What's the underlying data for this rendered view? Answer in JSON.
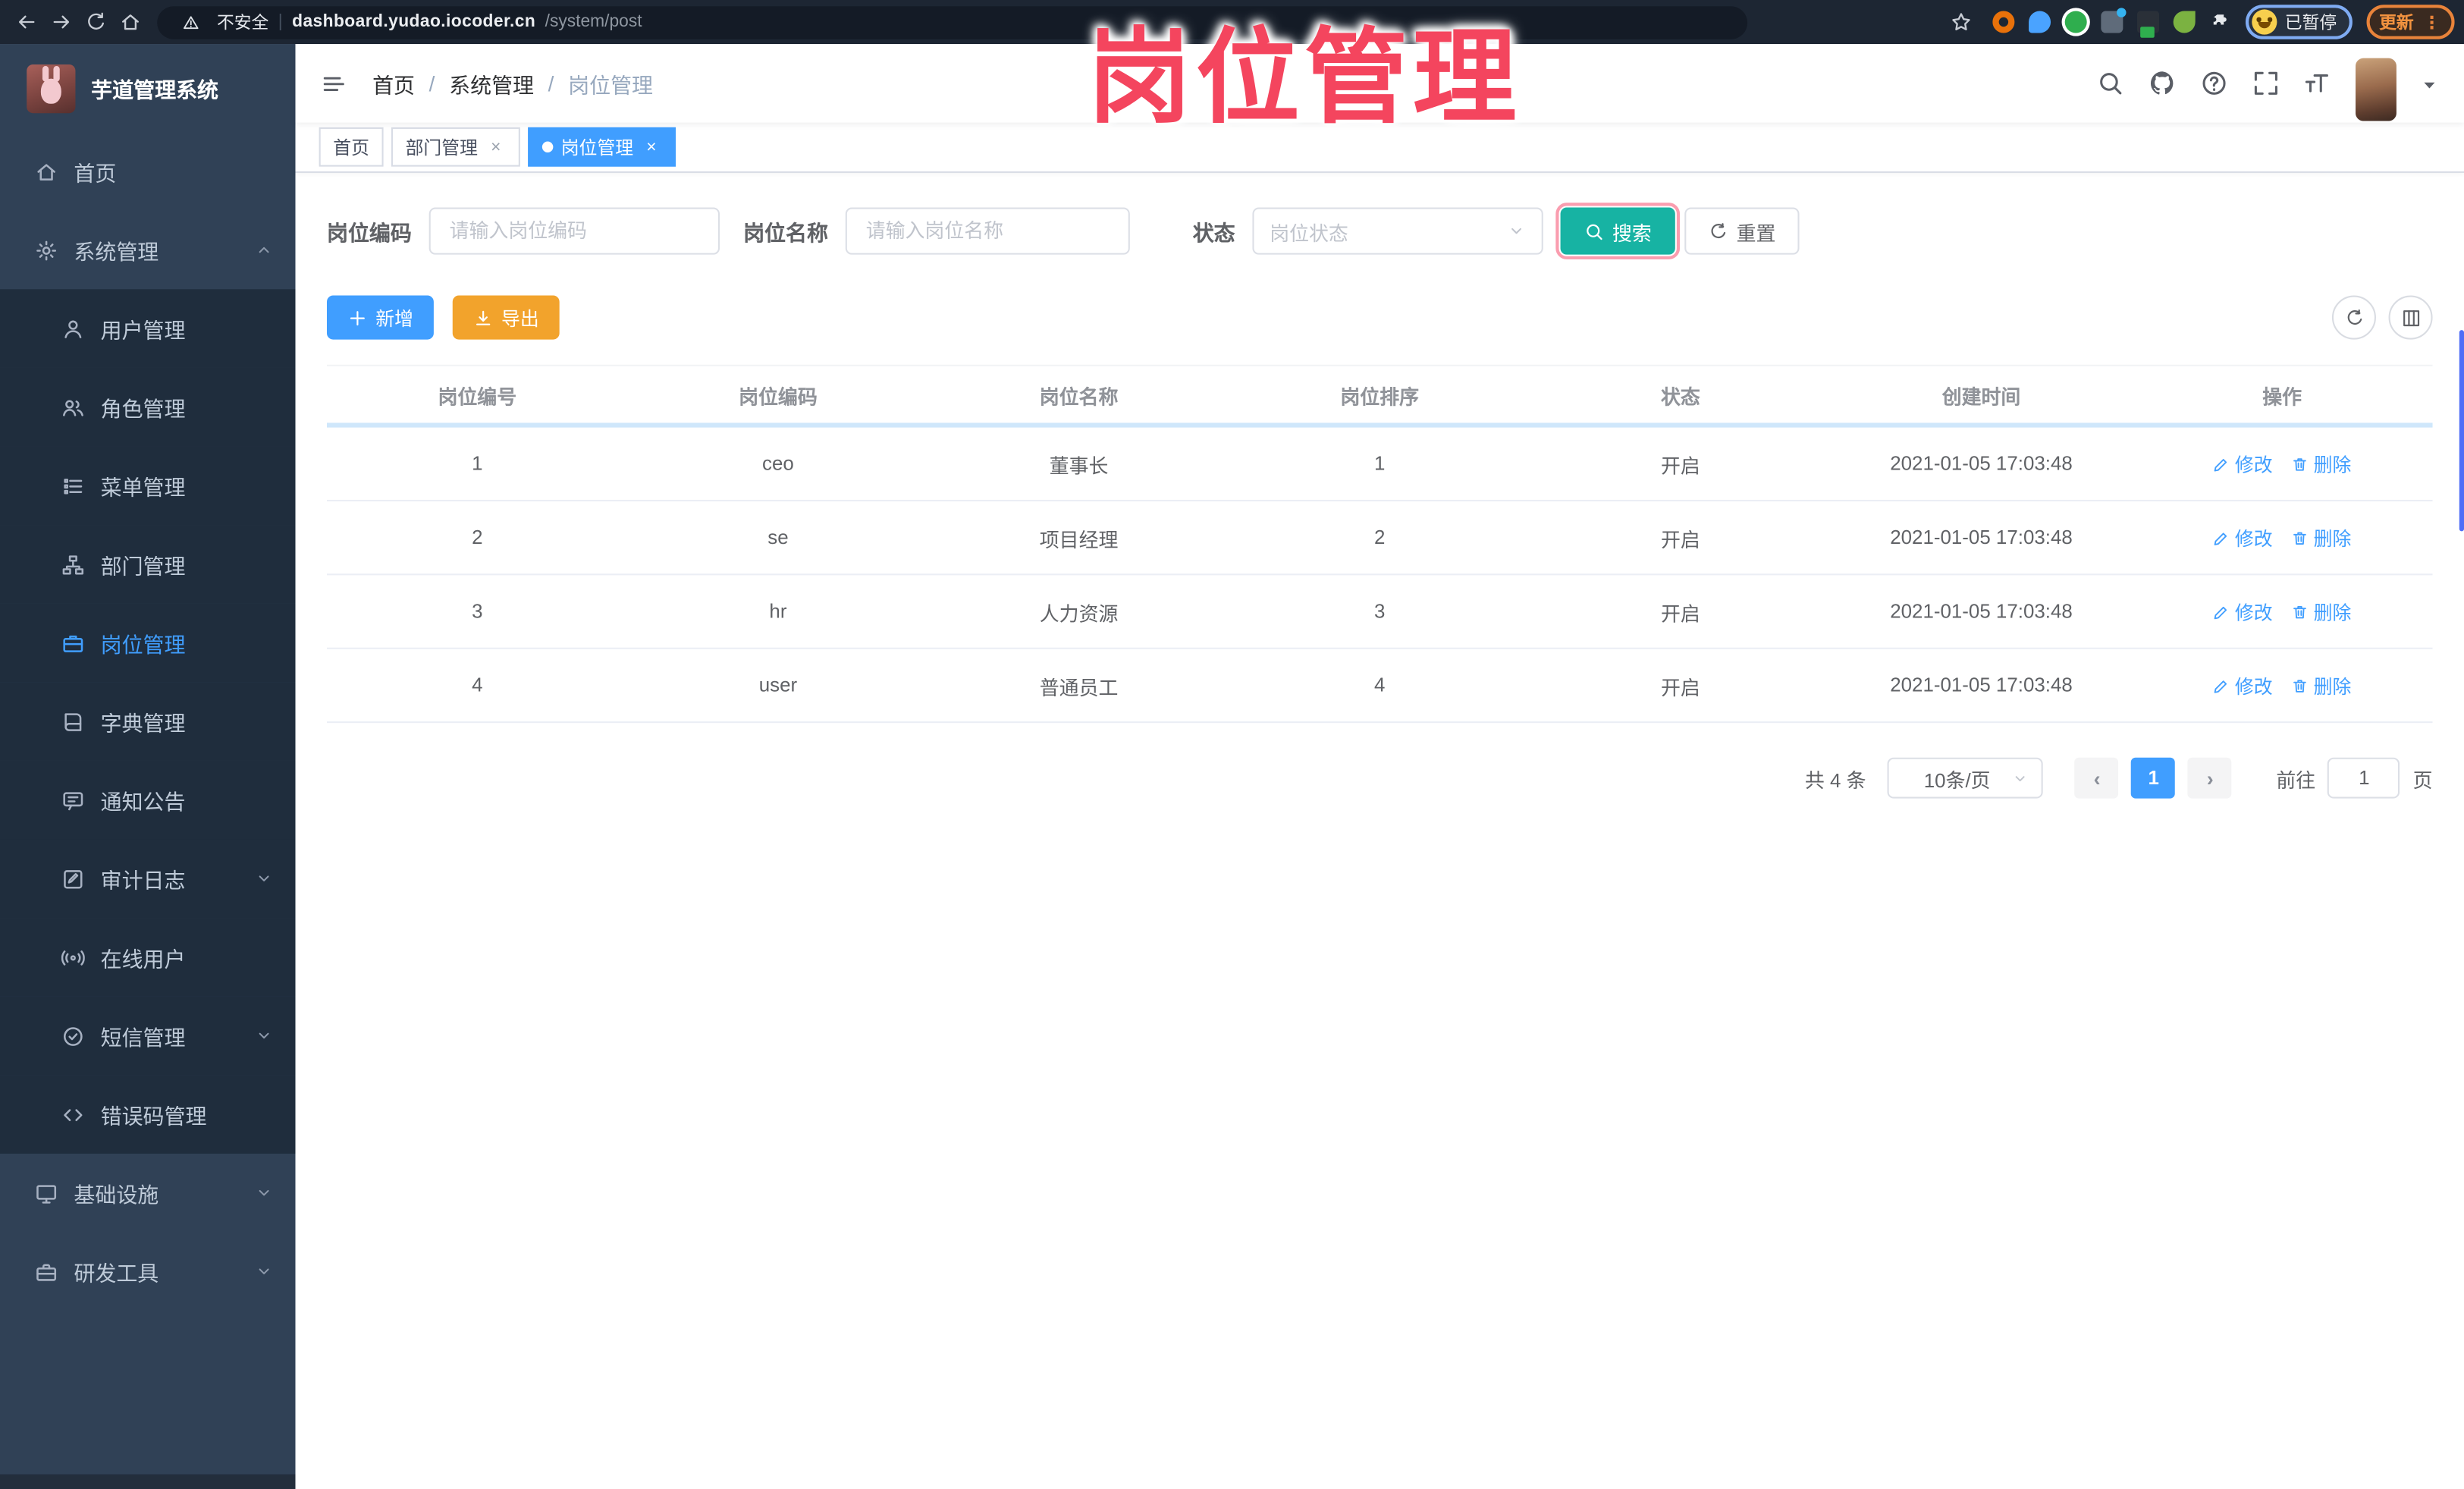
{
  "browser": {
    "security_label": "不安全",
    "url_host": "dashboard.yudao.iocoder.cn",
    "url_path": "/system/post",
    "profile_status": "已暂停",
    "update_label": "更新"
  },
  "symbols": {
    "pipe": "|",
    "close": "×",
    "prev": "‹",
    "next": "›",
    "dots": "⋮"
  },
  "watermark": "岗位管理",
  "sidebar": {
    "title": "芋道管理系统",
    "items": [
      {
        "label": "首页",
        "icon": "home"
      },
      {
        "label": "系统管理",
        "icon": "gear"
      },
      {
        "label": "用户管理",
        "icon": "user"
      },
      {
        "label": "角色管理",
        "icon": "users"
      },
      {
        "label": "菜单管理",
        "icon": "menu-list"
      },
      {
        "label": "部门管理",
        "icon": "org-tree"
      },
      {
        "label": "岗位管理",
        "icon": "briefcase"
      },
      {
        "label": "字典管理",
        "icon": "book"
      },
      {
        "label": "通知公告",
        "icon": "announcement"
      },
      {
        "label": "审计日志",
        "icon": "audit-log"
      },
      {
        "label": "在线用户",
        "icon": "online-user"
      },
      {
        "label": "短信管理",
        "icon": "sms"
      },
      {
        "label": "错误码管理",
        "icon": "error-code"
      },
      {
        "label": "基础设施",
        "icon": "infrastructure"
      },
      {
        "label": "研发工具",
        "icon": "dev-tools"
      }
    ]
  },
  "breadcrumb": {
    "home": "首页",
    "section": "系统管理",
    "current": "岗位管理",
    "separator": "/"
  },
  "tabs": [
    {
      "label": "首页"
    },
    {
      "label": "部门管理"
    },
    {
      "label": "岗位管理"
    }
  ],
  "filters": {
    "code_label": "岗位编码",
    "code_placeholder": "请输入岗位编码",
    "name_label": "岗位名称",
    "name_placeholder": "请输入岗位名称",
    "status_label": "状态",
    "status_placeholder": "岗位状态",
    "search_label": "搜索",
    "reset_label": "重置"
  },
  "toolbar": {
    "add_label": "新增",
    "export_label": "导出"
  },
  "table": {
    "columns": [
      "岗位编号",
      "岗位编码",
      "岗位名称",
      "岗位排序",
      "状态",
      "创建时间",
      "操作"
    ],
    "rows": [
      {
        "id": "1",
        "code": "ceo",
        "name": "董事长",
        "sort": "1",
        "status": "开启",
        "created": "2021-01-05 17:03:48"
      },
      {
        "id": "2",
        "code": "se",
        "name": "项目经理",
        "sort": "2",
        "status": "开启",
        "created": "2021-01-05 17:03:48"
      },
      {
        "id": "3",
        "code": "hr",
        "name": "人力资源",
        "sort": "3",
        "status": "开启",
        "created": "2021-01-05 17:03:48"
      },
      {
        "id": "4",
        "code": "user",
        "name": "普通员工",
        "sort": "4",
        "status": "开启",
        "created": "2021-01-05 17:03:48"
      }
    ],
    "edit_label": "修改",
    "delete_label": "删除"
  },
  "pagination": {
    "total": "共 4 条",
    "page_size": "10条/页",
    "page": "1",
    "goto": "前往",
    "goto_value": "1",
    "unit": "页"
  },
  "colors": {
    "accent": "#409EFF",
    "search_button": "#17b3a3",
    "warning_button": "#f2a32c",
    "sidebar_bg": "#304156",
    "sidebar_sub_bg": "#1f2d3d",
    "watermark": "#f4455e"
  }
}
